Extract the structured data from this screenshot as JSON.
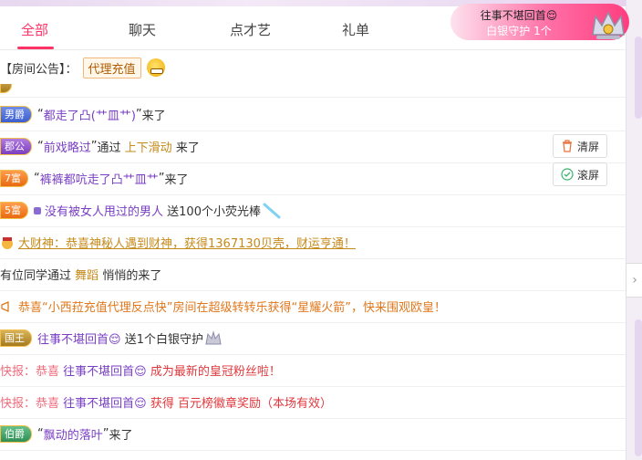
{
  "tabs": [
    {
      "label": "全部",
      "active": true
    },
    {
      "label": "聊天"
    },
    {
      "label": "点才艺"
    },
    {
      "label": "礼单"
    }
  ],
  "guard_banner": {
    "line1": "往事不堪回首😌",
    "line2": "白银守护 1个"
  },
  "announcement": {
    "prefix": "【房间公告】：",
    "tag": "代理充值"
  },
  "buttons": {
    "clear": "清屏",
    "scroll": "滚屏"
  },
  "colors": {
    "accent": "#ff3366",
    "gold": "#c58a1a",
    "red": "#e0383d"
  },
  "feed": [
    {
      "badge": "男爵",
      "quote_open": "“",
      "name": "都走了凸(艹皿艹)",
      "quote_close": "”",
      "text": "来了"
    },
    {
      "badge": "郡公",
      "quote_open": "“",
      "name": "前戏略过",
      "quote_close": "”",
      "text_a": "通过",
      "method": "上下滑动",
      "text_b": "来了"
    },
    {
      "badge": "7富",
      "quote_open": "“",
      "name": "裤裤都吭走了凸艹皿艹",
      "quote_close": "”",
      "text": "来了"
    },
    {
      "badge": "5富",
      "name": "没有被女人甩过的男人",
      "text": "送100个小荧光棒"
    },
    {
      "text": "大财神：恭喜神秘人遇到财神，获得1367130贝壳，财运亨通！"
    },
    {
      "text_a": "有位同学通过",
      "method": "舞蹈",
      "text_b": "悄悄的来了"
    },
    {
      "text": "恭喜“小西菈充值代理反点快”房间在超级转转乐获得“星耀火箭”，快来围观欧皇！"
    },
    {
      "badge": "国王",
      "name": "往事不堪回首😌",
      "text": "送1个白银守护"
    },
    {
      "prefix": "快报：恭喜",
      "name": "往事不堪回首😌",
      "text": "成为最新的皇冠粉丝啦！"
    },
    {
      "prefix": "快报：恭喜",
      "name": "往事不堪回首😌",
      "text_a": "获得",
      "text_b": "百元榜徽章奖励（本场有效）"
    },
    {
      "badge": "伯爵",
      "quote_open": "“",
      "name": "飘动的落叶",
      "quote_close": "”",
      "text": "来了"
    }
  ]
}
